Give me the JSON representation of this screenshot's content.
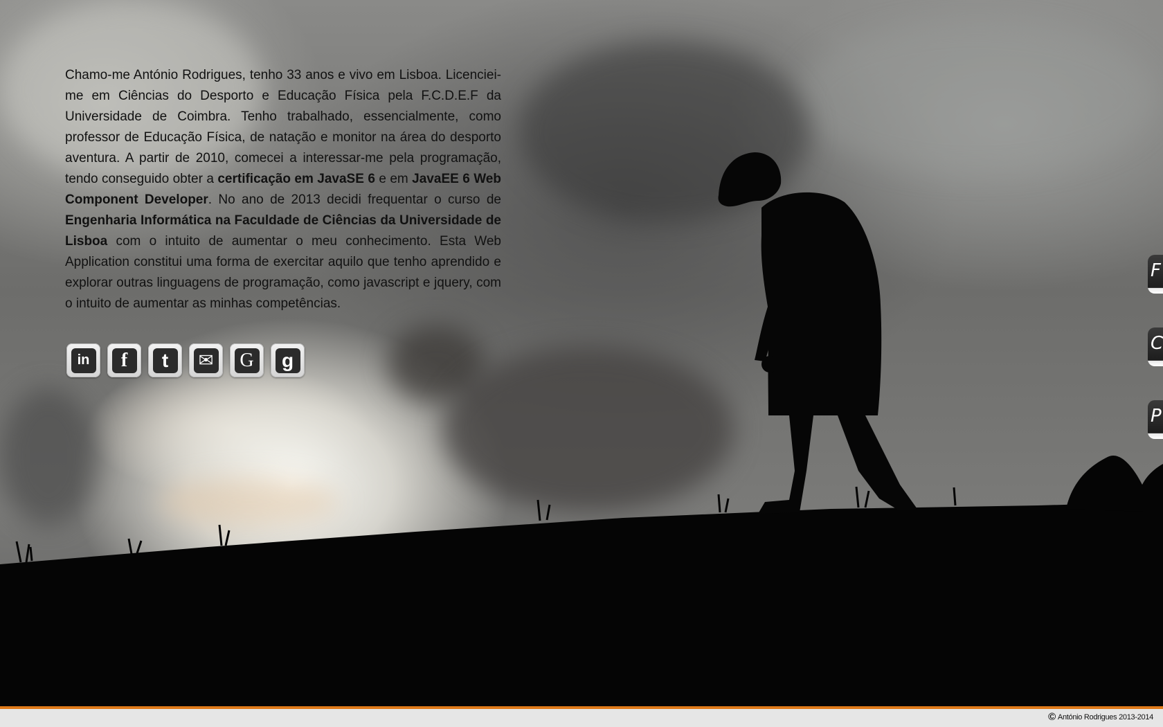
{
  "bio": {
    "p1": "Chamo-me António Rodrigues, tenho 33 anos e vivo em Lisboa. Licenciei-me em Ciências do Desporto e Educação Física pela F.C.D.E.F da Universidade de Coimbra. Tenho trabalhado, essencialmente, como professor de Educação Física, de natação e monitor na área do desporto aventura. A partir de 2010, comecei a interessar-me pela programação, tendo conseguido obter a ",
    "b1": "certificação em JavaSE 6",
    "p2": " e em ",
    "b2": "JavaEE 6 Web Component Developer",
    "p3": ". No ano de 2013 decidi frequentar o curso de ",
    "b3": "Engenharia Informática na Faculdade de Ciências da Universidade de Lisboa",
    "p4": " com o intuito de aumentar o meu conhecimento. Esta Web Application constitui uma forma de exercitar aquilo que tenho aprendido e explorar outras linguagens de programação, como javascript e jquery, com o intuito de aumentar as minhas competências."
  },
  "social": [
    {
      "icon": "linkedin-icon",
      "glyph": "in"
    },
    {
      "icon": "facebook-icon",
      "glyph": "f"
    },
    {
      "icon": "twitter-icon",
      "glyph": "t"
    },
    {
      "icon": "email-icon",
      "glyph": "✉"
    },
    {
      "icon": "google-icon",
      "glyph": "G"
    },
    {
      "icon": "google-plus-icon",
      "glyph": "g"
    }
  ],
  "side_tabs": [
    "F",
    "C",
    "P"
  ],
  "footer": {
    "copyright_symbol": "©",
    "copyright_text": "António Rodrigues 2013-2014",
    "accent_color": "#e07a1a"
  }
}
